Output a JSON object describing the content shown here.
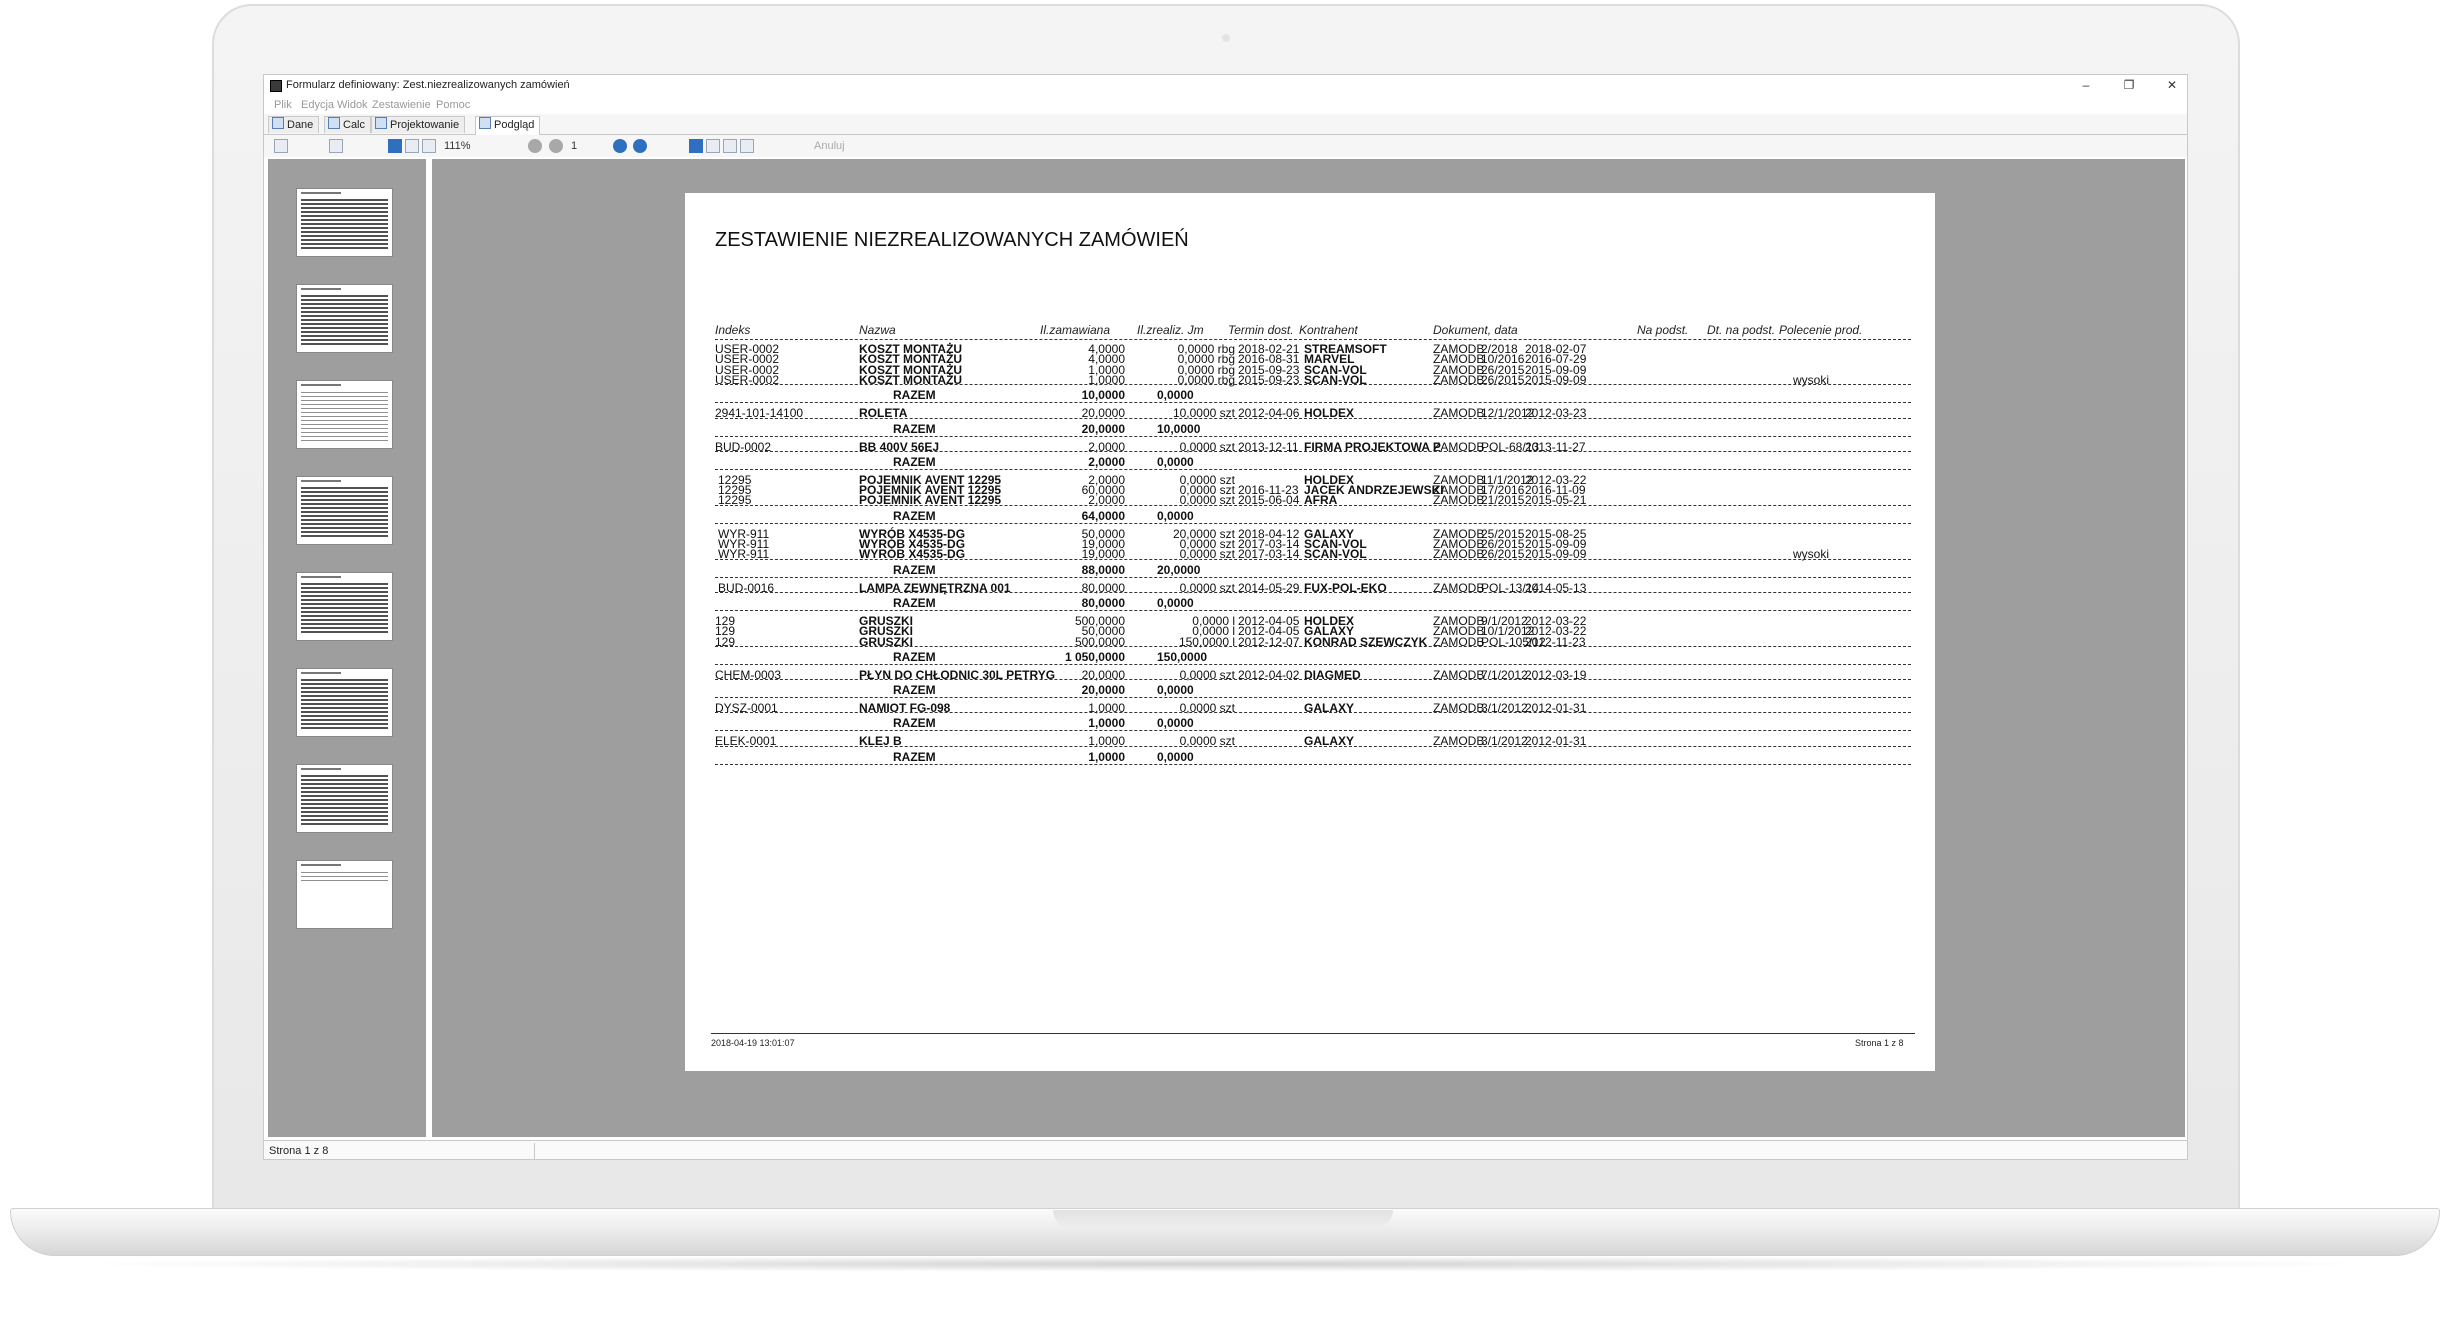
{
  "window": {
    "title": "Formularz definiowany: Zest.niezrealizowanych zamówień",
    "minimize": "–",
    "restore": "❐",
    "close": "✕"
  },
  "menu": [
    "Plik",
    "Edycja",
    "Widok",
    "Zestawienie",
    "Pomoc"
  ],
  "tabs": [
    {
      "label": "Dane",
      "active": false
    },
    {
      "label": "Calc",
      "active": false
    },
    {
      "label": "Projektowanie",
      "active": false
    },
    {
      "label": "Podgląd",
      "active": true
    }
  ],
  "toolbar": {
    "zoom": "111%",
    "page": "1",
    "cancel": "Anuluj"
  },
  "report": {
    "title": "ZESTAWIENIE NIEZREALIZOWANYCH ZAMÓWIEŃ",
    "headers": [
      "Indeks",
      "Nazwa",
      "Il.zamawiana",
      "Il.zrealiz. Jm",
      "Termin dost.",
      "Kontrahent",
      "Dokument, data",
      "Na podst.",
      "Dt. na podst.",
      "Polecenie prod."
    ],
    "total_label": "RAZEM",
    "groups": [
      {
        "rows": [
          [
            "USER-0002",
            "KOSZT MONTAŻU",
            "4,0000",
            "0,0000 rbg",
            "2018-02-21",
            "STREAMSOFT",
            "ZAMODB",
            "2/2018",
            "2018-02-07",
            ""
          ],
          [
            "USER-0002",
            "KOSZT MONTAŻU",
            "4,0000",
            "0,0000 rbg",
            "2016-08-31",
            "MARVEL",
            "ZAMODB",
            "10/2016",
            "2016-07-29",
            ""
          ],
          [
            "USER-0002",
            "KOSZT MONTAŻU",
            "1,0000",
            "0,0000 rbg",
            "2015-09-23",
            "SCAN-VOL",
            "ZAMODB",
            "26/2015",
            "2015-09-09",
            ""
          ],
          [
            "USER-0002",
            "KOSZT MONTAŻU",
            "1,0000",
            "0,0000 rbg",
            "2015-09-23",
            "SCAN-VOL",
            "ZAMODB",
            "26/2015",
            "2015-09-09",
            "wysoki"
          ]
        ],
        "total_qty": "10,0000",
        "total_done": "0,0000"
      },
      {
        "rows": [
          [
            "2941-101-14100",
            "ROLETA",
            "20,0000",
            "10,0000 szt",
            "2012-04-06",
            "HOLDEX",
            "ZAMODB",
            "12/1/2012",
            "2012-03-23",
            ""
          ]
        ],
        "total_qty": "20,0000",
        "total_done": "10,0000"
      },
      {
        "rows": [
          [
            "BUD-0002",
            "BB 400V 56EJ",
            "2,0000",
            "0,0000 szt",
            "2013-12-11",
            "FIRMA PROJEKTOWA P",
            "ZAMODB",
            "POL-68/13",
            "2013-11-27",
            ""
          ]
        ],
        "total_qty": "2,0000",
        "total_done": "0,0000"
      },
      {
        "rows": [
          [
            "12295",
            "POJEMNIK AVENT 12295",
            "2,0000",
            "0,0000 szt",
            "",
            "HOLDEX",
            "ZAMODB",
            "11/1/2012",
            "2012-03-22",
            ""
          ],
          [
            "12295",
            "POJEMNIK AVENT 12295",
            "60,0000",
            "0,0000 szt",
            "2016-11-23",
            "JACEK ANDRZEJEWSKI",
            "ZAMODB",
            "17/2016",
            "2016-11-09",
            ""
          ],
          [
            "12295",
            "POJEMNIK AVENT 12295",
            "2,0000",
            "0,0000 szt",
            "2015-06-04",
            "AFRA",
            "ZAMODB",
            "21/2015",
            "2015-05-21",
            ""
          ]
        ],
        "total_qty": "64,0000",
        "total_done": "0,0000"
      },
      {
        "rows": [
          [
            "WYR-911",
            "WYRÓB X4535-DG",
            "50,0000",
            "20,0000 szt",
            "2018-04-12",
            "GALAXY",
            "ZAMODB",
            "25/2015",
            "2015-08-25",
            ""
          ],
          [
            "WYR-911",
            "WYRÓB X4535-DG",
            "19,0000",
            "0,0000 szt",
            "2017-03-14",
            "SCAN-VOL",
            "ZAMODB",
            "26/2015",
            "2015-09-09",
            ""
          ],
          [
            "WYR-911",
            "WYRÓB X4535-DG",
            "19,0000",
            "0,0000 szt",
            "2017-03-14",
            "SCAN-VOL",
            "ZAMODB",
            "26/2015",
            "2015-09-09",
            "wysoki"
          ]
        ],
        "total_qty": "88,0000",
        "total_done": "20,0000"
      },
      {
        "rows": [
          [
            "BUD-0016",
            "LAMPA ZEWNĘTRZNA 001",
            "80,0000",
            "0,0000 szt",
            "2014-05-29",
            "FUX-POL-EKO",
            "ZAMODB",
            "POL-13/14",
            "2014-05-13",
            ""
          ]
        ],
        "total_qty": "80,0000",
        "total_done": "0,0000"
      },
      {
        "rows": [
          [
            "129",
            "GRUSZKI",
            "500,0000",
            "0,0000 l",
            "2012-04-05",
            "HOLDEX",
            "ZAMODB",
            "9/1/2012",
            "2012-03-22",
            ""
          ],
          [
            "129",
            "GRUSZKI",
            "50,0000",
            "0,0000 l",
            "2012-04-05",
            "GALAXY",
            "ZAMODB",
            "10/1/2012",
            "2012-03-22",
            ""
          ],
          [
            "129",
            "GRUSZKI",
            "500,0000",
            "150,0000 l",
            "2012-12-07",
            "KONRAD SZEWCZYK",
            "ZAMODB",
            "POL-105/12",
            "2012-11-23",
            ""
          ]
        ],
        "total_qty": "1 050,0000",
        "total_done": "150,0000"
      },
      {
        "rows": [
          [
            "CHEM-0003",
            "PŁYN DO CHŁODNIC 30L PETRYG",
            "20,0000",
            "0,0000 szt",
            "2012-04-02",
            "DIAGMED",
            "ZAMODB",
            "7/1/2012",
            "2012-03-19",
            ""
          ]
        ],
        "total_qty": "20,0000",
        "total_done": "0,0000"
      },
      {
        "rows": [
          [
            "DYSZ-0001",
            "NAMIOT FG-098",
            "1,0000",
            "0,0000 szt",
            "",
            "GALAXY",
            "ZAMODB",
            "3/1/2012",
            "2012-01-31",
            ""
          ]
        ],
        "total_qty": "1,0000",
        "total_done": "0,0000"
      },
      {
        "rows": [
          [
            "ELEK-0001",
            "KLEJ B",
            "1,0000",
            "0,0000 szt",
            "",
            "GALAXY",
            "ZAMODB",
            "3/1/2012",
            "2012-01-31",
            ""
          ]
        ],
        "total_qty": "1,0000",
        "total_done": "0,0000"
      }
    ],
    "footer_left": "2018-04-19 13:01:07",
    "footer_right": "Strona 1 z 8"
  },
  "thumbnails": 8,
  "status": "Strona 1 z 8"
}
